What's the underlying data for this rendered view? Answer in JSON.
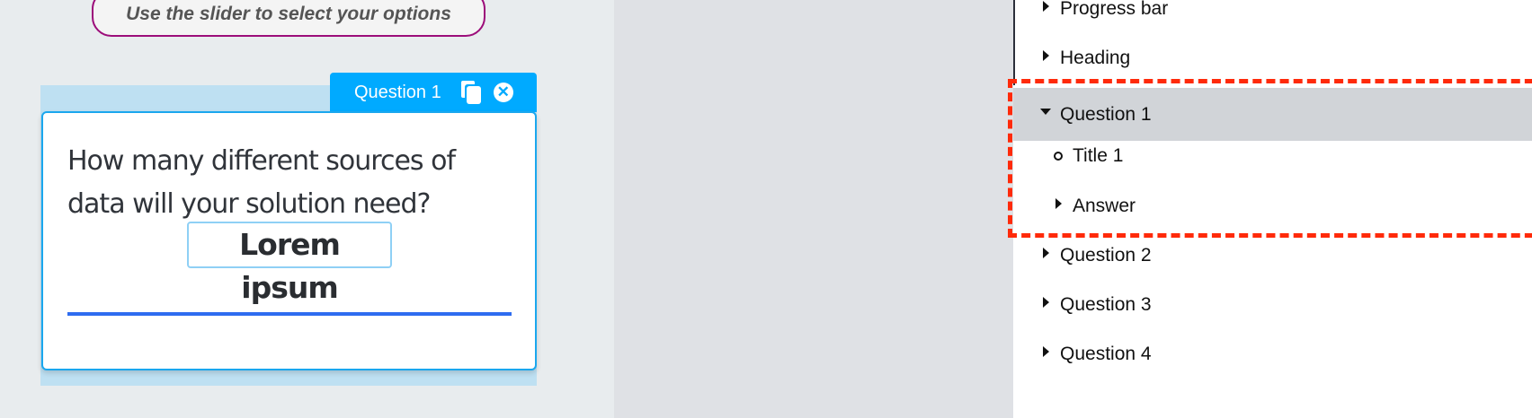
{
  "banner": {
    "text": "Use the slider to select your options"
  },
  "question_card": {
    "tab_label": "Question 1",
    "question_text": "How many different sources of data will your solution need?",
    "title_value": "Lorem ipsum"
  },
  "tree": {
    "items": [
      {
        "label": "Progress bar",
        "icon": "caret-right"
      },
      {
        "label": "Heading",
        "icon": "caret-right"
      },
      {
        "label": "Question 1",
        "icon": "caret-down"
      },
      {
        "label": "Title 1",
        "icon": "circle"
      },
      {
        "label": "Answer",
        "icon": "caret-right"
      },
      {
        "label": "Question 2",
        "icon": "caret-right"
      },
      {
        "label": "Question 3",
        "icon": "caret-right"
      },
      {
        "label": "Question 4",
        "icon": "caret-right"
      }
    ]
  },
  "colors": {
    "accent": "#00aaff",
    "highlight": "#ff2a0a",
    "slider": "#2e6cf0"
  }
}
